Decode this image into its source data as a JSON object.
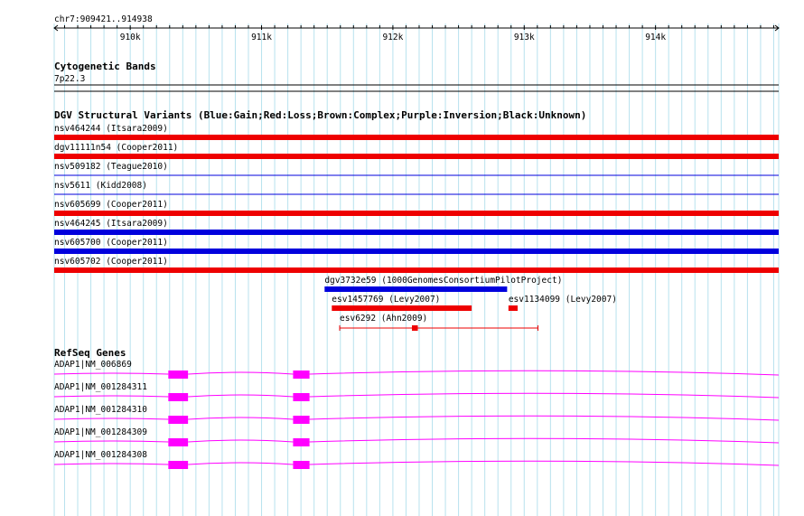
{
  "locus": {
    "label": "chr7:909421..914938",
    "start": 909421,
    "end": 914938
  },
  "ruler": {
    "ticks": [
      {
        "pos": 910000,
        "label": "910k"
      },
      {
        "pos": 911000,
        "label": "911k"
      },
      {
        "pos": 912000,
        "label": "912k"
      },
      {
        "pos": 913000,
        "label": "913k"
      },
      {
        "pos": 914000,
        "label": "914k"
      }
    ]
  },
  "tracks": {
    "cytoband": {
      "title": "Cytogenetic Bands",
      "band": "7p22.3"
    },
    "dgv": {
      "title": "DGV Structural Variants (Blue:Gain;Red:Loss;Brown:Complex;Purple:Inversion;Black:Unknown)",
      "colors": {
        "gain": "#0000dd",
        "loss": "#ee0000"
      },
      "features": [
        {
          "id": "nsv464244",
          "label": "nsv464244 (Itsara2009)",
          "type": "loss",
          "start": 909421,
          "end": 914938,
          "style": "bar",
          "row": 0
        },
        {
          "id": "dgv11111n54",
          "label": "dgv11111n54 (Cooper2011)",
          "type": "loss",
          "start": 909421,
          "end": 914938,
          "style": "bar",
          "row": 1
        },
        {
          "id": "nsv509182",
          "label": "nsv509182 (Teague2010)",
          "type": "gain",
          "start": 909421,
          "end": 914938,
          "style": "line",
          "row": 2
        },
        {
          "id": "nsv5611",
          "label": "nsv5611 (Kidd2008)",
          "type": "gain",
          "start": 909421,
          "end": 914938,
          "style": "line",
          "row": 3
        },
        {
          "id": "nsv605699",
          "label": "nsv605699 (Cooper2011)",
          "type": "loss",
          "start": 909421,
          "end": 914938,
          "style": "bar",
          "row": 4
        },
        {
          "id": "nsv464245",
          "label": "nsv464245 (Itsara2009)",
          "type": "gain",
          "start": 909421,
          "end": 914938,
          "style": "bar",
          "row": 5
        },
        {
          "id": "nsv605700",
          "label": "nsv605700 (Cooper2011)",
          "type": "gain",
          "start": 909421,
          "end": 914938,
          "style": "bar",
          "row": 6
        },
        {
          "id": "nsv605702",
          "label": "nsv605702 (Cooper2011)",
          "type": "loss",
          "start": 909421,
          "end": 914938,
          "style": "bar",
          "row": 7
        },
        {
          "id": "dgv3732e59",
          "label": "dgv3732e59 (1000GenomesConsortiumPilotProject)",
          "type": "gain",
          "start": 911480,
          "end": 912870,
          "style": "bar",
          "row": 8
        },
        {
          "id": "esv1457769",
          "label": "esv1457769 (Levy2007)",
          "type": "loss",
          "start": 911535,
          "end": 912600,
          "style": "bar",
          "row": 9
        },
        {
          "id": "esv1134099",
          "label": "esv1134099 (Levy2007)",
          "type": "loss",
          "start": 912880,
          "end": 912950,
          "style": "bar",
          "row": 9
        },
        {
          "id": "esv6292",
          "label": "esv6292 (Ahn2009)",
          "type": "loss",
          "start": 911595,
          "end": 913105,
          "style": "paired",
          "mid_start": 912145,
          "mid_end": 912190,
          "row": 10
        }
      ]
    },
    "refseq": {
      "title": "RefSeq Genes",
      "color": "#ff00ff",
      "exons": [
        {
          "start": 910290,
          "end": 910440
        },
        {
          "start": 911240,
          "end": 911365
        }
      ],
      "genes": [
        {
          "label": "ADAP1|NM_006869"
        },
        {
          "label": "ADAP1|NM_001284311"
        },
        {
          "label": "ADAP1|NM_001284310"
        },
        {
          "label": "ADAP1|NM_001284309"
        },
        {
          "label": "ADAP1|NM_001284308"
        }
      ]
    }
  },
  "colors": {
    "grid": "#b8e2ee",
    "ruler": "#000000"
  }
}
